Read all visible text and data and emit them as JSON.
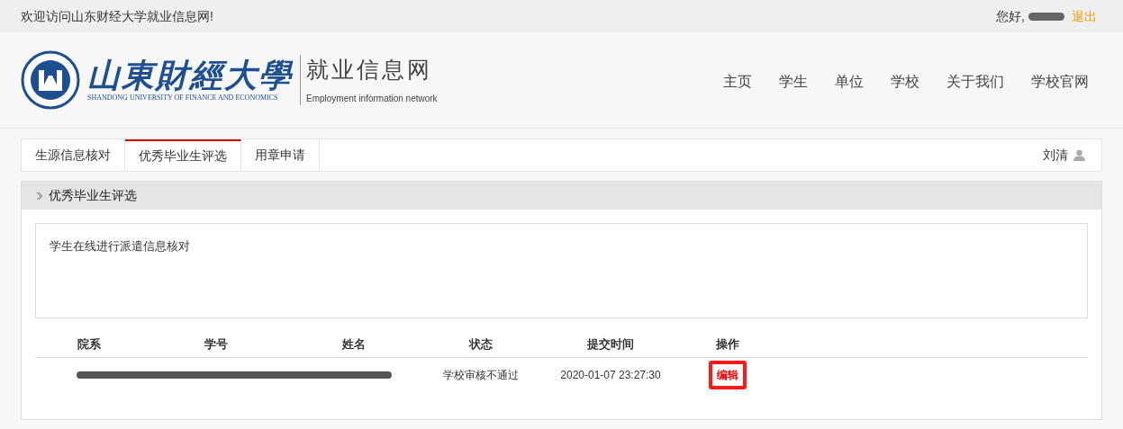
{
  "top_bar": {
    "welcome": "欢迎访问山东财经大学就业信息网!",
    "greeting": "您好,",
    "logout": "退出"
  },
  "header": {
    "logo_name": "山東財經大學",
    "logo_english": "SHANDONG UNIVERSITY OF FINANCE AND ECONOMICS",
    "site_title": "就业信息网",
    "site_subtitle": "Employment information network",
    "nav": [
      "主页",
      "学生",
      "单位",
      "学校",
      "关于我们",
      "学校官网"
    ]
  },
  "tabs": [
    {
      "label": "生源信息核对",
      "selected": false
    },
    {
      "label": "优秀毕业生评选",
      "selected": true
    },
    {
      "label": "用章申请",
      "selected": false
    }
  ],
  "user": "刘清",
  "panel": {
    "title": "优秀毕业生评选",
    "notice": "学生在线进行派遣信息核对",
    "table": {
      "columns": [
        "院系",
        "学号",
        "姓名",
        "状态",
        "提交时间",
        "操作"
      ],
      "rows": [
        {
          "status": "学校审核不通过",
          "time": "2020-01-07 23:27:30",
          "action": "编辑"
        }
      ]
    }
  }
}
